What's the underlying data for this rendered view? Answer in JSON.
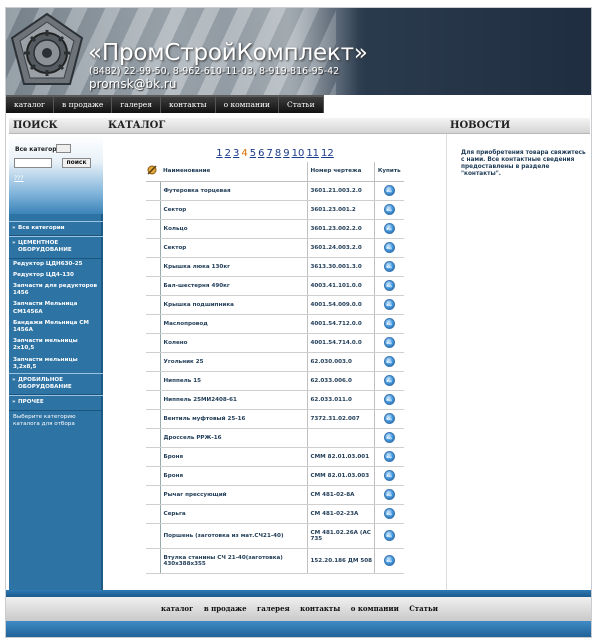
{
  "header": {
    "title": "«ПромСтройКомплект»",
    "phones": "(8482) 22-99-50, 8-962-610-11-03, 8-919-816-95-42",
    "email": "promsk@bk.ru"
  },
  "topnav": [
    "каталог",
    "в продаже",
    "галерея",
    "контакты",
    "о компании",
    "Статьи"
  ],
  "sections": {
    "search": "ПОИСК",
    "catalog": "КАТАЛОГ",
    "news": "НОВОСТИ"
  },
  "search": {
    "label": "Все категор",
    "button": "поиск",
    "advanced": "???"
  },
  "categories": [
    {
      "kind": "group",
      "label": "Все категории"
    },
    {
      "kind": "group",
      "label": "ЦЕМЕНТНОЕ ОБОРУДОВАНИЕ"
    },
    {
      "kind": "sub",
      "label": "Редуктор ЦДН630-25"
    },
    {
      "kind": "sub",
      "label": "Редуктор ЦД4-130"
    },
    {
      "kind": "sub",
      "label": "Запчасти для редукторов 1456"
    },
    {
      "kind": "sub",
      "label": "Запчасти Мельница СМ1456А"
    },
    {
      "kind": "sub",
      "label": "Бандажи Мельница СМ 1456А"
    },
    {
      "kind": "sub",
      "label": "Запчасти мельницы 2х10,5"
    },
    {
      "kind": "sub",
      "label": "Запчасти мельницы 3,2х8,5"
    },
    {
      "kind": "group",
      "label": "ДРОБИЛЬНОЕ ОБОРУДОВАНИЕ"
    },
    {
      "kind": "group",
      "label": "ПРОЧЕЕ"
    },
    {
      "kind": "note",
      "label": "Выберите категорию каталога для отбора"
    }
  ],
  "pager": {
    "pages": [
      "1",
      "2",
      "3",
      "4",
      "5",
      "6",
      "7",
      "8",
      "9",
      "10",
      "11",
      "12"
    ],
    "current": "4"
  },
  "table": {
    "headers": [
      "Наименование",
      "Номер чертежа",
      "Купить"
    ],
    "buy_label": "Buy",
    "rows": [
      {
        "name": "Футеровка торцевая",
        "number": "3601.21.003.2.0"
      },
      {
        "name": "Сектор",
        "number": "3601.23.001.2"
      },
      {
        "name": "Кольцо",
        "number": "3601.23.002.2.0"
      },
      {
        "name": "Сектор",
        "number": "3601.24.003.2.0"
      },
      {
        "name": "Крышка люка 130кг",
        "number": "3613.30.001.3.0"
      },
      {
        "name": "Бал-шестерня 490кг",
        "number": "4003.41.101.0.0"
      },
      {
        "name": "Крышка подшипника",
        "number": "4001.54.009.0.0"
      },
      {
        "name": "Маслопровод",
        "number": "4001.54.712.0.0"
      },
      {
        "name": "Колено",
        "number": "4001.54.714.0.0"
      },
      {
        "name": "Угольник 25",
        "number": "62.030.003.0"
      },
      {
        "name": "Ниппель 15",
        "number": "62.033.006.0"
      },
      {
        "name": "Ниппель 25МИ2408-61",
        "number": "62.033.011.0"
      },
      {
        "name": "Вентиль муфтовый 25-16",
        "number": "7372.31.02.007"
      },
      {
        "name": "Дроссель РРЖ-16",
        "number": ""
      },
      {
        "name": "Броня",
        "number": "СММ 82.01.03.001"
      },
      {
        "name": "Броня",
        "number": "СММ 82.01.03.003"
      },
      {
        "name": "Рычаг прессующий",
        "number": "СМ 481-02-8А"
      },
      {
        "name": "Серьга",
        "number": "СМ 481-02-23А"
      },
      {
        "name": "Поршень (заготовка из мат.СЧ21-40)",
        "number": "СМ 481.02.26А (АС 735"
      },
      {
        "name": "Втулка станины СЧ 21-40(заготовка) 430х388х355",
        "number": "152.20.186 ДМ 508"
      }
    ]
  },
  "news": {
    "text": "Для приобретения товара свяжитесь с нами. Все контактные сведения предоставлены в разделе \"контакты\"."
  },
  "footer_nav": [
    "каталог",
    "в продаже",
    "галерея",
    "контакты",
    "о компании",
    "Статьи"
  ]
}
